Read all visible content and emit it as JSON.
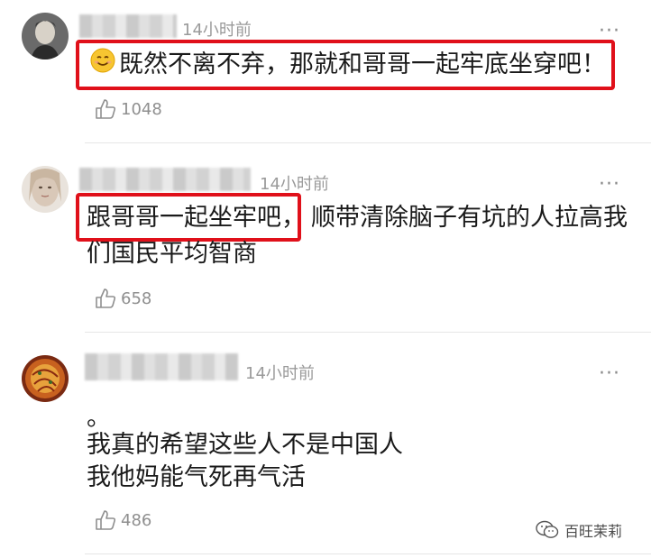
{
  "comments": [
    {
      "time": "14小时前",
      "text_line1": "既然不离不弃，那就和哥哥一起牢底坐穿吧！",
      "likes": "1048"
    },
    {
      "time": "14小时前",
      "text_line1_highlight": "跟哥哥一起坐牢吧，",
      "text_line1_rest": "顺带清除脑子有坑的人拉高我",
      "text_line2": "们国民平均智商",
      "likes": "658"
    },
    {
      "time": "14小时前",
      "text_line1": "。",
      "text_line2": "我真的希望这些人不是中国人",
      "text_line3": "我他妈能气死再气活",
      "likes": "486"
    }
  ],
  "more_label": "···",
  "watermark": {
    "label": "百旺茉莉"
  },
  "colors": {
    "highlight": "#e0101a",
    "secondary_text": "#9a9a9a"
  },
  "icons": [
    "smile-emoji-icon",
    "thumbs-up-icon",
    "more-dots-icon",
    "wechat-icon"
  ]
}
